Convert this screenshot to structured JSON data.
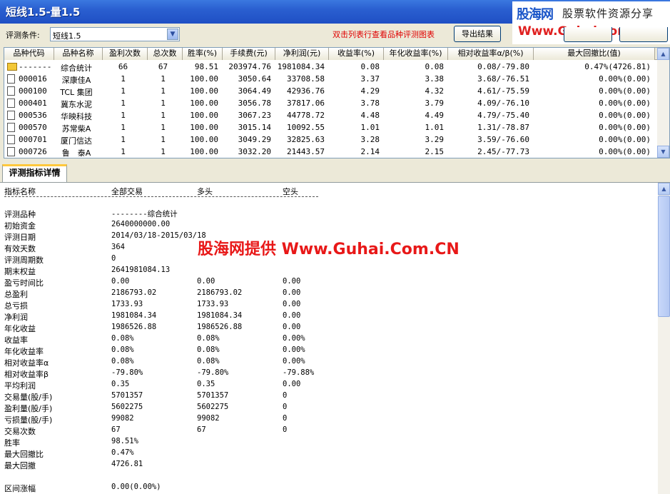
{
  "window": {
    "title": "短线1.5-量1.5"
  },
  "logo": {
    "brand": "股海网",
    "slogan": "股票软件资源分享",
    "url": "Www.Guhai.com.cn"
  },
  "criteria": {
    "label": "评测条件:",
    "value": "短线1.5"
  },
  "hint": "双击列表行查看品种评测图表",
  "buttons": {
    "export": "导出结果"
  },
  "table": {
    "headers": [
      "品种代码",
      "品种名称",
      "盈利次数",
      "总次数",
      "胜率(%)",
      "手续费(元)",
      "净利润(元)",
      "收益率(%)",
      "年化收益率(%)",
      "相对收益率α/β(%)",
      "最大回撤比(值)"
    ],
    "rows": [
      [
        "-------",
        "综合统计",
        "66",
        "67",
        "98.51",
        "203974.76",
        "1981084.34",
        "0.08",
        "0.08",
        "0.08/-79.80",
        "0.47%(4726.81)"
      ],
      [
        "000016",
        "深康佳A",
        "1",
        "1",
        "100.00",
        "3050.64",
        "33708.58",
        "3.37",
        "3.38",
        "3.68/-76.51",
        "0.00%(0.00)"
      ],
      [
        "000100",
        "TCL 集团",
        "1",
        "1",
        "100.00",
        "3064.49",
        "42936.76",
        "4.29",
        "4.32",
        "4.61/-75.59",
        "0.00%(0.00)"
      ],
      [
        "000401",
        "冀东水泥",
        "1",
        "1",
        "100.00",
        "3056.78",
        "37817.06",
        "3.78",
        "3.79",
        "4.09/-76.10",
        "0.00%(0.00)"
      ],
      [
        "000536",
        "华映科技",
        "1",
        "1",
        "100.00",
        "3067.23",
        "44778.72",
        "4.48",
        "4.49",
        "4.79/-75.40",
        "0.00%(0.00)"
      ],
      [
        "000570",
        "苏常柴A",
        "1",
        "1",
        "100.00",
        "3015.14",
        "10092.55",
        "1.01",
        "1.01",
        "1.31/-78.87",
        "0.00%(0.00)"
      ],
      [
        "000701",
        "厦门信达",
        "1",
        "1",
        "100.00",
        "3049.29",
        "32825.63",
        "3.28",
        "3.29",
        "3.59/-76.60",
        "0.00%(0.00)"
      ],
      [
        "000726",
        "鲁　泰A",
        "1",
        "1",
        "100.00",
        "3032.20",
        "21443.57",
        "2.14",
        "2.15",
        "2.45/-77.73",
        "0.00%(0.00)"
      ]
    ]
  },
  "tab": {
    "label": "评测指标详情"
  },
  "detail": {
    "header": [
      "指标名称",
      "全部交易",
      "多头",
      "空头"
    ],
    "rows": [
      [
        "评测品种",
        "--------综合统计",
        "",
        ""
      ],
      [
        "初始资金",
        "2640000000.00",
        "",
        ""
      ],
      [
        "评测日期",
        "2014/03/18-2015/03/18",
        "",
        ""
      ],
      [
        "有效天数",
        "364",
        "",
        ""
      ],
      [
        "评测周期数",
        "0",
        "",
        ""
      ],
      [
        "期末权益",
        "2641981084.13",
        "",
        ""
      ],
      [
        "盈亏时间比",
        "0.00",
        "0.00",
        "0.00"
      ],
      [
        "总盈利",
        "2186793.02",
        "2186793.02",
        "0.00"
      ],
      [
        "总亏损",
        "1733.93",
        "1733.93",
        "0.00"
      ],
      [
        "净利润",
        "1981084.34",
        "1981084.34",
        "0.00"
      ],
      [
        "年化收益",
        "1986526.88",
        "1986526.88",
        "0.00"
      ],
      [
        "收益率",
        "0.08%",
        "0.08%",
        "0.00%"
      ],
      [
        "年化收益率",
        "0.08%",
        "0.08%",
        "0.00%"
      ],
      [
        "相对收益率α",
        "0.08%",
        " 0.08%",
        " 0.00%"
      ],
      [
        "相对收益率β",
        "-79.80%",
        "  -79.80%",
        "  -79.88%"
      ],
      [
        "平均利润",
        "0.35",
        "0.35",
        "0.00"
      ],
      [
        "交易量(股/手)",
        "5701357",
        "5701357",
        "0"
      ],
      [
        "盈利量(股/手)",
        "5602275",
        "5602275",
        "0"
      ],
      [
        "亏损量(股/手)",
        "99082",
        "99082",
        "0"
      ],
      [
        "交易次数",
        "67",
        "67",
        "0"
      ],
      [
        "胜率",
        "98.51%",
        "",
        ""
      ],
      [
        "最大回撤比",
        "0.47%",
        "",
        ""
      ],
      [
        "最大回撤",
        "4726.81",
        "",
        ""
      ],
      [
        "",
        "",
        "",
        ""
      ],
      [
        "区间涨幅",
        "0.00(0.00%)",
        "",
        ""
      ]
    ],
    "watermark": "股海网提供 Www.Guhai.Com.CN"
  }
}
